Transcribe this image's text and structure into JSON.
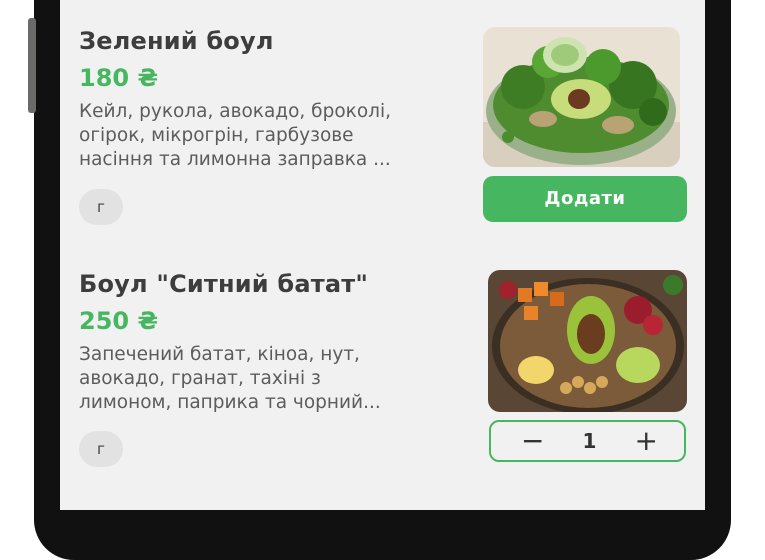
{
  "products": [
    {
      "title": "Зелений боул",
      "price": "180 ₴",
      "description_lines": [
        "Кейл, рукола, авокадо, броколі,",
        "огірок, мікрогрін, гарбузове",
        "насіння та лимонна заправка ..."
      ],
      "unit_chip": "г",
      "image_icon": "green-bowl-image",
      "action_label": "Додати"
    },
    {
      "title": "Боул \"Ситний батат\"",
      "price": "250 ₴",
      "description_lines": [
        "Запечений батат, кіноа, нут,",
        "авокадо, гранат, тахіні з",
        "лимоном, паприка та чорний..."
      ],
      "unit_chip": "г",
      "image_icon": "sweet-potato-bowl-image",
      "quantity": "1",
      "minus_symbol": "−",
      "plus_symbol": "+"
    }
  ],
  "colors": {
    "accent": "#46b760",
    "screen_bg": "#f1f1f1",
    "text_primary": "#3d3d3d",
    "text_secondary": "#5c5c5c"
  }
}
